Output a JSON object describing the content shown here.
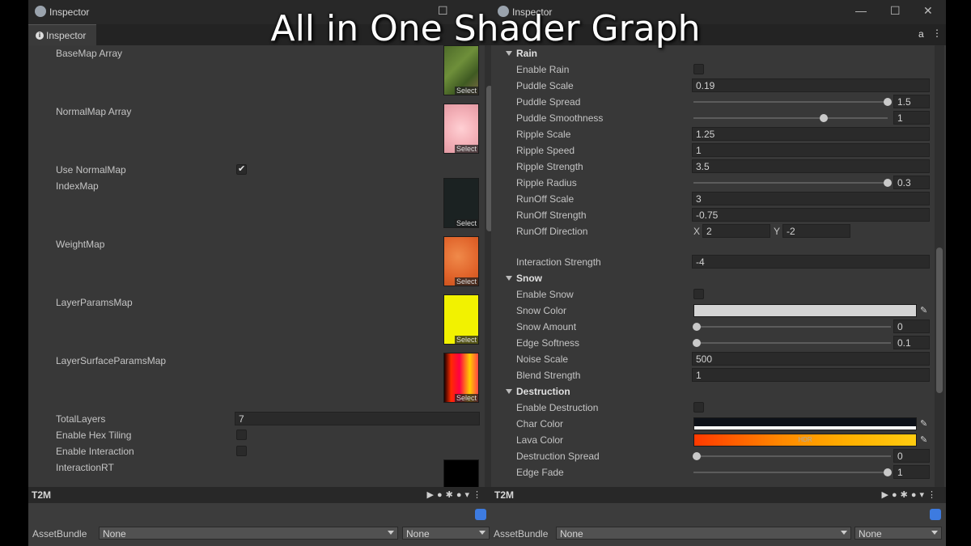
{
  "headline": "All in One Shader Graph",
  "colors": {
    "panel_bg": "#383838",
    "field_bg": "#2a2a2a",
    "titlebar": "#282828",
    "accent_blue": "#3d7be0"
  },
  "left": {
    "title": "Inspector",
    "tab": "Inspector",
    "icons": {
      "tab": "info-icon",
      "window": "unity-inspector-icon"
    },
    "rows": {
      "basemap": {
        "label": "BaseMap Array",
        "select": "Select"
      },
      "normalmap": {
        "label": "NormalMap Array",
        "select": "Select"
      },
      "use_normalmap": {
        "label": "Use NormalMap",
        "checked": true
      },
      "indexmap": {
        "label": "IndexMap",
        "select": "Select"
      },
      "weightmap": {
        "label": "WeightMap",
        "select": "Select"
      },
      "layerparams": {
        "label": "LayerParamsMap",
        "select": "Select"
      },
      "layersurface": {
        "label": "LayerSurfaceParamsMap",
        "select": "Select"
      },
      "total_layers": {
        "label": "TotalLayers",
        "value": "7"
      },
      "hex_tiling": {
        "label": "Enable Hex Tiling",
        "checked": false
      },
      "interaction": {
        "label": "Enable Interaction",
        "checked": false
      },
      "interaction_rt": {
        "label": "InteractionRT"
      }
    },
    "bottom": {
      "name": "T2M"
    },
    "assetbundle": {
      "label": "AssetBundle",
      "name_value": "None",
      "variant_value": "None"
    }
  },
  "right": {
    "title": "Inspector",
    "icons": {
      "window": "unity-inspector-icon",
      "lock": "lock-icon",
      "menu": "kebab-menu-icon"
    },
    "rain": {
      "header": "Rain",
      "enable_rain": {
        "label": "Enable Rain",
        "checked": false
      },
      "puddle_scale": {
        "label": "Puddle Scale",
        "value": "0.19"
      },
      "puddle_spread": {
        "label": "Puddle Spread",
        "value": "1.5",
        "fraction": 1.0
      },
      "puddle_smoothness": {
        "label": "Puddle Smoothness",
        "value": "1",
        "fraction": 0.67
      },
      "ripple_scale": {
        "label": "Ripple Scale",
        "value": "1.25"
      },
      "ripple_speed": {
        "label": "Ripple Speed",
        "value": "1"
      },
      "ripple_strength": {
        "label": "Ripple Strength",
        "value": "3.5"
      },
      "ripple_radius": {
        "label": "Ripple Radius",
        "value": "0.3",
        "fraction": 1.0
      },
      "runoff_scale": {
        "label": "RunOff Scale",
        "value": "3"
      },
      "runoff_strength": {
        "label": "RunOff Strength",
        "value": "-0.75"
      },
      "runoff_direction": {
        "label": "RunOff Direction",
        "x_label": "X",
        "x": "2",
        "y_label": "Y",
        "y": "-2"
      },
      "interaction_strength": {
        "label": "Interaction Strength",
        "value": "-4"
      }
    },
    "snow": {
      "header": "Snow",
      "enable_snow": {
        "label": "Enable Snow",
        "checked": false
      },
      "snow_color": {
        "label": "Snow Color",
        "color": "#d4d4d4"
      },
      "snow_amount": {
        "label": "Snow Amount",
        "value": "0",
        "fraction": 0.0
      },
      "edge_softness": {
        "label": "Edge Softness",
        "value": "0.1",
        "fraction": 0.0
      },
      "noise_scale": {
        "label": "Noise Scale",
        "value": "500"
      },
      "blend_strength": {
        "label": "Blend Strength",
        "value": "1"
      }
    },
    "destruction": {
      "header": "Destruction",
      "enable_destruction": {
        "label": "Enable Destruction",
        "checked": false
      },
      "char_color": {
        "label": "Char Color",
        "color": "#0d1118"
      },
      "lava_color": {
        "label": "Lava Color",
        "hdr": "HDR"
      },
      "destruction_spread": {
        "label": "Destruction Spread",
        "value": "0",
        "fraction": 0.0
      },
      "edge_fade": {
        "label": "Edge Fade",
        "value": "1",
        "fraction": 1.0
      }
    },
    "bottom": {
      "name": "T2M"
    },
    "assetbundle": {
      "label": "AssetBundle",
      "name_value": "None",
      "variant_value": "None"
    }
  }
}
